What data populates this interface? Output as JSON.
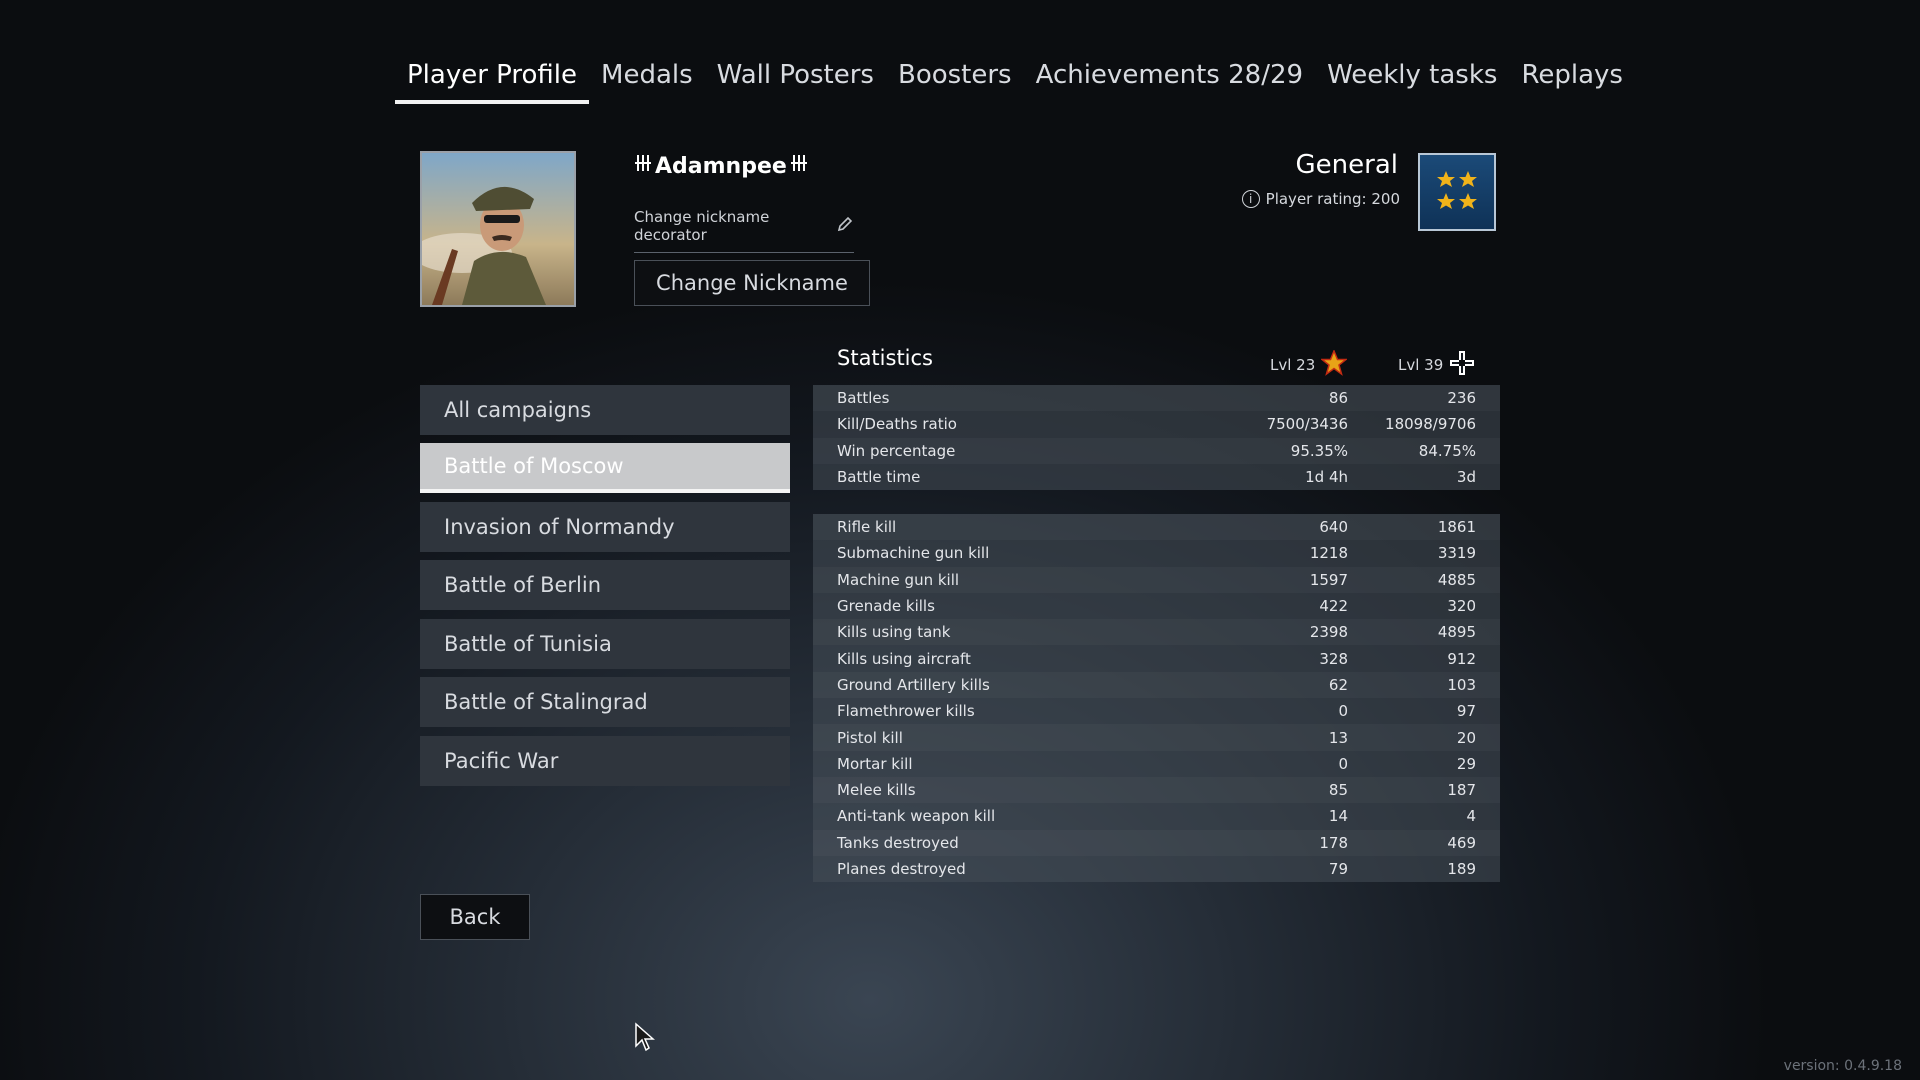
{
  "tabs": [
    {
      "label": "Player Profile",
      "active": true
    },
    {
      "label": "Medals"
    },
    {
      "label": "Wall Posters"
    },
    {
      "label": "Boosters"
    },
    {
      "label": "Achievements 28/29"
    },
    {
      "label": "Weekly tasks"
    },
    {
      "label": "Replays"
    }
  ],
  "profile": {
    "nickname": "Adamnpee",
    "decorator_label": "Change nickname decorator",
    "change_nickname_label": "Change Nickname",
    "rank": "General",
    "rating_label": "Player rating: 200"
  },
  "campaigns": [
    {
      "label": "All campaigns"
    },
    {
      "label": "Battle of Moscow",
      "active": true
    },
    {
      "label": "Invasion of Normandy"
    },
    {
      "label": "Battle of Berlin"
    },
    {
      "label": "Battle of Tunisia"
    },
    {
      "label": "Battle of Stalingrad"
    },
    {
      "label": "Pacific War"
    }
  ],
  "back_label": "Back",
  "statistics": {
    "title": "Statistics",
    "col1_level": "Lvl 23",
    "col2_level": "Lvl 39",
    "general": [
      {
        "label": "Battles",
        "v1": "86",
        "v2": "236"
      },
      {
        "label": "Kill/Deaths ratio",
        "v1": "7500/3436",
        "v2": "18098/9706"
      },
      {
        "label": "Win percentage",
        "v1": "95.35%",
        "v2": "84.75%"
      },
      {
        "label": "Battle time",
        "v1": "1d 4h",
        "v2": "3d"
      }
    ],
    "kills": [
      {
        "label": "Rifle kill",
        "v1": "640",
        "v2": "1861"
      },
      {
        "label": "Submachine gun kill",
        "v1": "1218",
        "v2": "3319"
      },
      {
        "label": "Machine gun kill",
        "v1": "1597",
        "v2": "4885"
      },
      {
        "label": "Grenade kills",
        "v1": "422",
        "v2": "320"
      },
      {
        "label": "Kills using tank",
        "v1": "2398",
        "v2": "4895"
      },
      {
        "label": "Kills using aircraft",
        "v1": "328",
        "v2": "912"
      },
      {
        "label": "Ground Artillery kills",
        "v1": "62",
        "v2": "103"
      },
      {
        "label": "Flamethrower kills",
        "v1": "0",
        "v2": "97"
      },
      {
        "label": "Pistol kill",
        "v1": "13",
        "v2": "20"
      },
      {
        "label": "Mortar kill",
        "v1": "0",
        "v2": "29"
      },
      {
        "label": "Melee kills",
        "v1": "85",
        "v2": "187"
      },
      {
        "label": "Anti-tank weapon kill",
        "v1": "14",
        "v2": "4"
      },
      {
        "label": "Tanks destroyed",
        "v1": "178",
        "v2": "469"
      },
      {
        "label": "Planes destroyed",
        "v1": "79",
        "v2": "189"
      }
    ]
  },
  "version": "version: 0.4.9.18",
  "colors": {
    "accent_star": "#e8a317",
    "badge_blue": "#1b4a78"
  }
}
